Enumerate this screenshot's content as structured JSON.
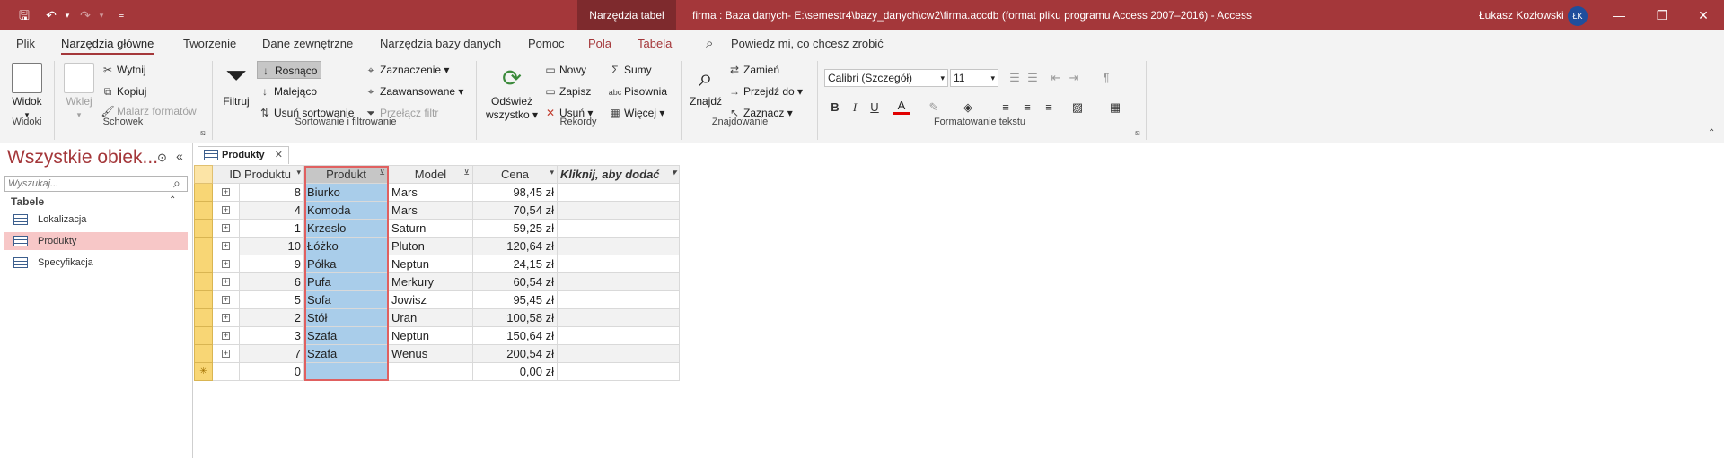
{
  "titlebar": {
    "context_tab": "Narzędzia tabel",
    "title": "firma : Baza danych- E:\\semestr4\\bazy_danych\\cw2\\firma.accdb (format pliku programu Access 2007–2016)  -  Access",
    "user": "Łukasz Kozłowski",
    "initials": "ŁK"
  },
  "menu": {
    "tabs": [
      "Plik",
      "Narzędzia główne",
      "Tworzenie",
      "Dane zewnętrzne",
      "Narzędzia bazy danych",
      "Pomoc",
      "Pola",
      "Tabela"
    ],
    "tell_me": "Powiedz mi, co chcesz zrobić"
  },
  "ribbon": {
    "widoki": {
      "widok": "Widok",
      "group": "Widoki"
    },
    "schowek": {
      "wklej": "Wklej",
      "wytnij": "Wytnij",
      "kopiuj": "Kopiuj",
      "malarz": "Malarz formatów",
      "group": "Schowek"
    },
    "sort": {
      "filtruj": "Filtruj",
      "rosnaco": "Rosnąco",
      "malejaco": "Malejąco",
      "usun_sort": "Usuń sortowanie",
      "zaznaczenie": "Zaznaczenie",
      "zaawansowane": "Zaawansowane",
      "przelacz": "Przełącz filtr",
      "group": "Sortowanie i filtrowanie"
    },
    "rekordy": {
      "odswiez": "Odśwież",
      "wszystko": "wszystko",
      "nowy": "Nowy",
      "zapisz": "Zapisz",
      "usun": "Usuń",
      "sumy": "Sumy",
      "pisownia": "Pisownia",
      "wiecej": "Więcej",
      "group": "Rekordy"
    },
    "znajdowanie": {
      "znajdz": "Znajdź",
      "zamien": "Zamień",
      "przejdz": "Przejdź do",
      "zaznacz": "Zaznacz",
      "group": "Znajdowanie"
    },
    "format": {
      "font": "Calibri (Szczegół)",
      "size": "11",
      "group": "Formatowanie tekstu"
    }
  },
  "nav": {
    "title": "Wszystkie obiek...",
    "search_placeholder": "Wyszukaj...",
    "section": "Tabele",
    "items": [
      "Lokalizacja",
      "Produkty",
      "Specyfikacja"
    ]
  },
  "doc": {
    "tab": "Produkty"
  },
  "grid": {
    "headers": [
      "ID Produktu",
      "Produkt",
      "Model",
      "Cena",
      "Kliknij, aby dodać"
    ],
    "rows": [
      [
        "8",
        "Biurko",
        "Mars",
        "98,45 zł"
      ],
      [
        "4",
        "Komoda",
        "Mars",
        "70,54 zł"
      ],
      [
        "1",
        "Krzesło",
        "Saturn",
        "59,25 zł"
      ],
      [
        "10",
        "Łóżko",
        "Pluton",
        "120,64 zł"
      ],
      [
        "9",
        "Półka",
        "Neptun",
        "24,15 zł"
      ],
      [
        "6",
        "Pufa",
        "Merkury",
        "60,54 zł"
      ],
      [
        "5",
        "Sofa",
        "Jowisz",
        "95,45 zł"
      ],
      [
        "2",
        "Stół",
        "Uran",
        "100,58 zł"
      ],
      [
        "3",
        "Szafa",
        "Neptun",
        "150,64 zł"
      ],
      [
        "7",
        "Szafa",
        "Wenus",
        "200,54 zł"
      ]
    ],
    "new_row": [
      "0",
      "",
      "",
      "0,00 zł"
    ]
  },
  "colors": {
    "accent": "#a4373a",
    "selection": "#a9cdea",
    "record_selector": "#f8d675"
  }
}
